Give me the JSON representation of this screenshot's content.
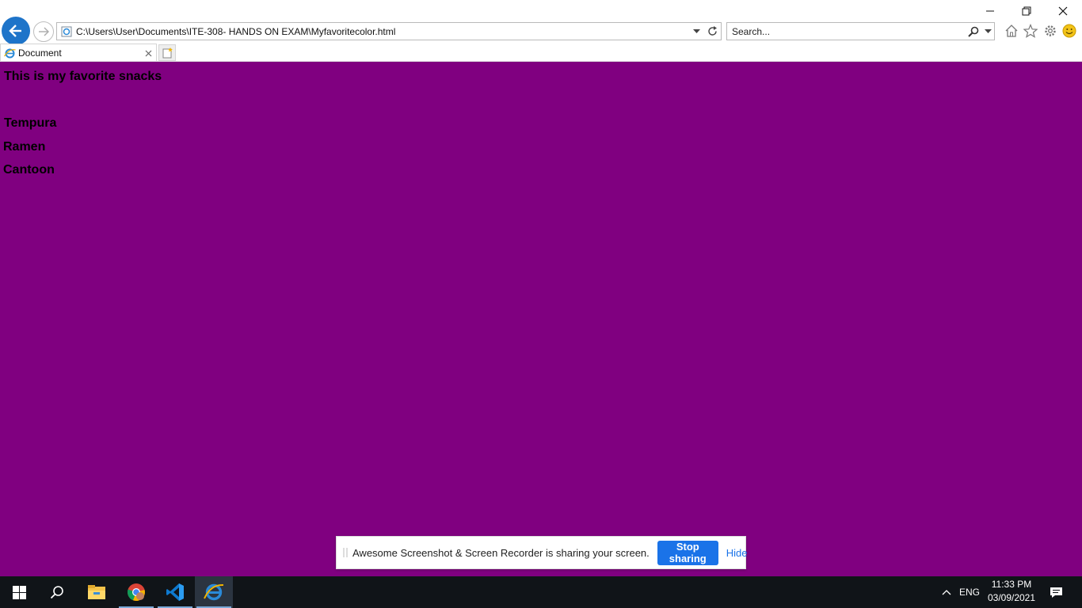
{
  "browser": {
    "address_url": "C:\\Users\\User\\Documents\\ITE-308- HANDS ON EXAM\\Myfavoritecolor.html",
    "search_placeholder": "Search...",
    "tab_title": "Document"
  },
  "page": {
    "background_color": "#800080",
    "heading": "This is my favorite snacks",
    "snacks": [
      "Tempura",
      "Ramen",
      "Cantoon"
    ]
  },
  "share_bar": {
    "message": "Awesome Screenshot & Screen Recorder is sharing your screen.",
    "stop_label": "Stop sharing",
    "hide_label": "Hide"
  },
  "taskbar": {
    "apps": [
      "start-icon",
      "search-icon",
      "file-explorer-icon",
      "chrome-icon",
      "vscode-icon",
      "internet-explorer-icon"
    ],
    "language": "ENG",
    "time": "11:33 PM",
    "date": "03/09/2021"
  }
}
